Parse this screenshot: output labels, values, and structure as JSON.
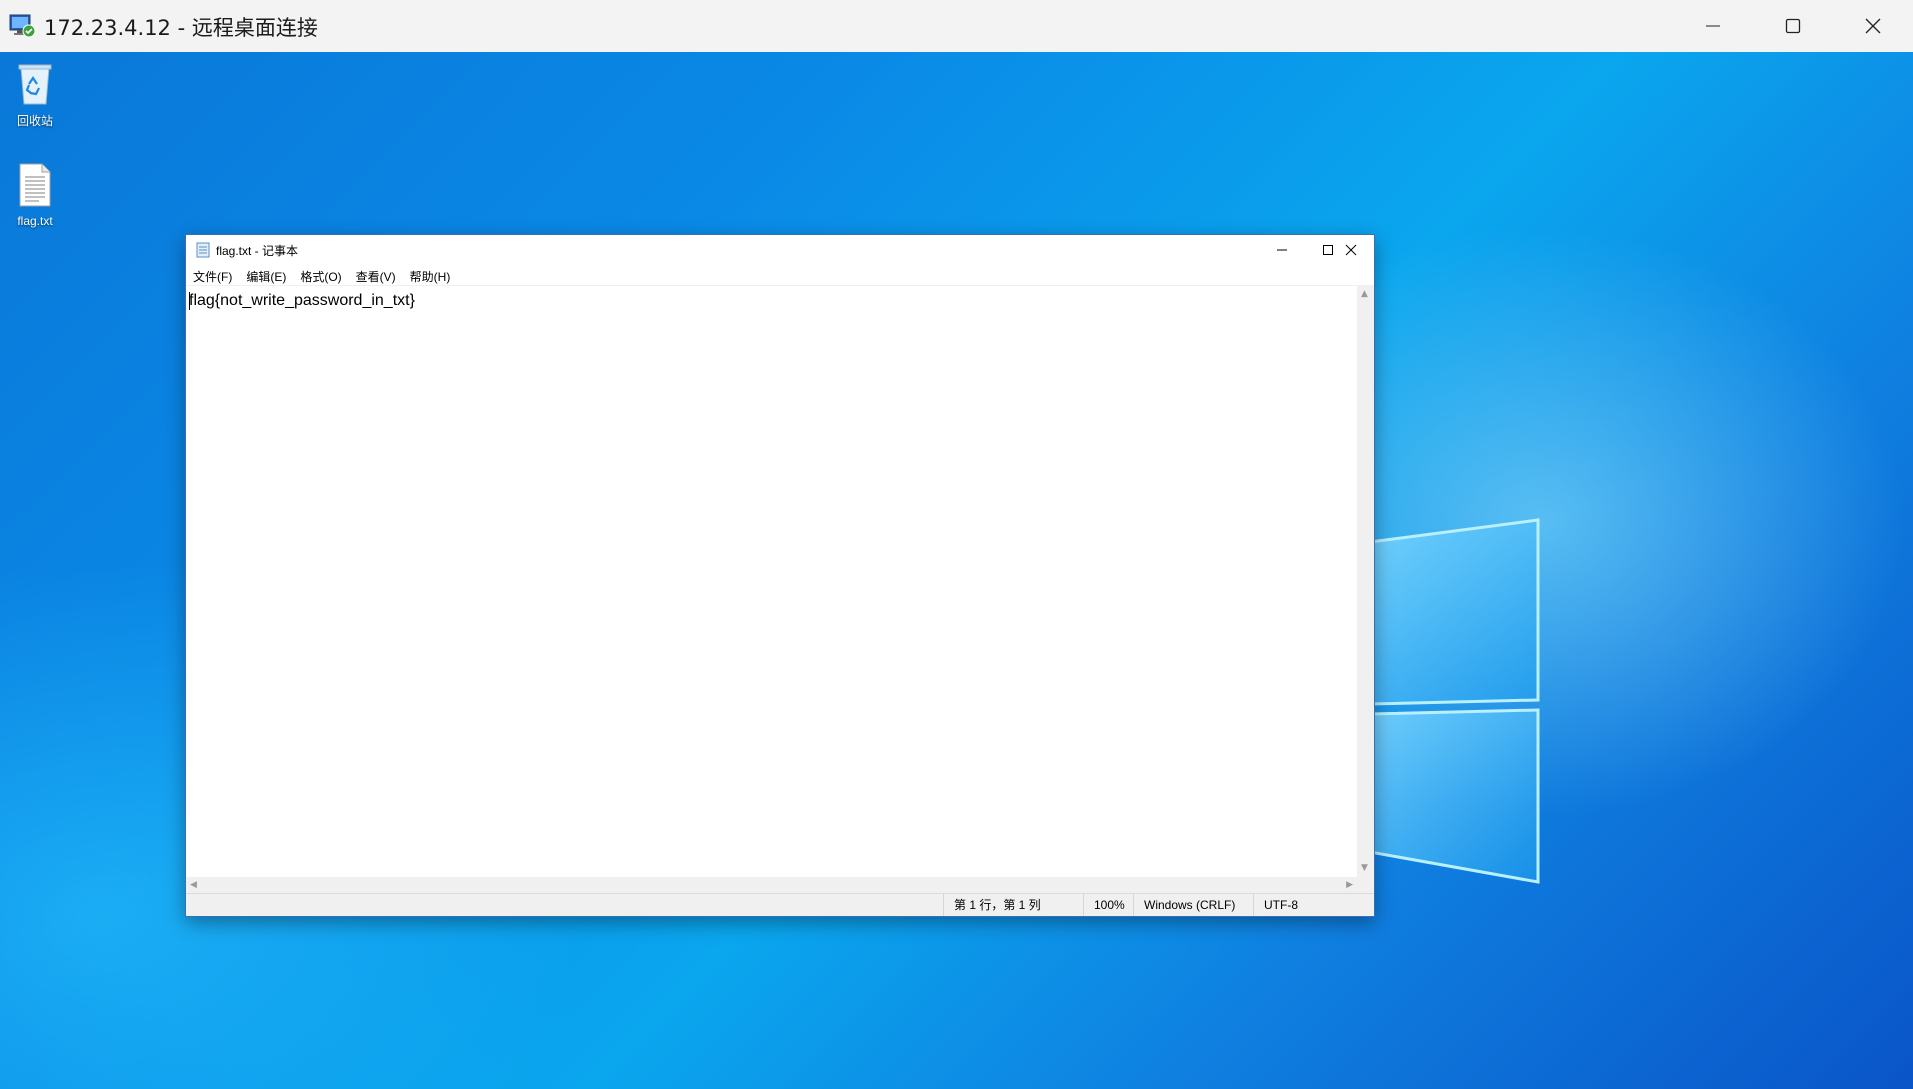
{
  "rdp": {
    "title": "172.23.4.12 - 远程桌面连接",
    "minimize_icon": "minimize-icon",
    "maximize_icon": "maximize-icon",
    "close_icon": "close-icon"
  },
  "desktop": {
    "icons": [
      {
        "label": "回收站",
        "icon": "recycle-bin-icon"
      },
      {
        "label": "flag.txt",
        "icon": "text-file-icon"
      }
    ]
  },
  "notepad": {
    "title": "flag.txt - 记事本",
    "menu": [
      "文件(F)",
      "编辑(E)",
      "格式(O)",
      "查看(V)",
      "帮助(H)"
    ],
    "content": "flag{not_write_password_in_txt}",
    "status": {
      "position": "第 1 行，第 1 列",
      "zoom": "100%",
      "line_ending": "Windows (CRLF)",
      "encoding": "UTF-8"
    }
  },
  "colors": {
    "desktop_blue": "#0a88e6",
    "titlebar": "#f3f3f3",
    "notepad_border": "#3a6fb0"
  }
}
